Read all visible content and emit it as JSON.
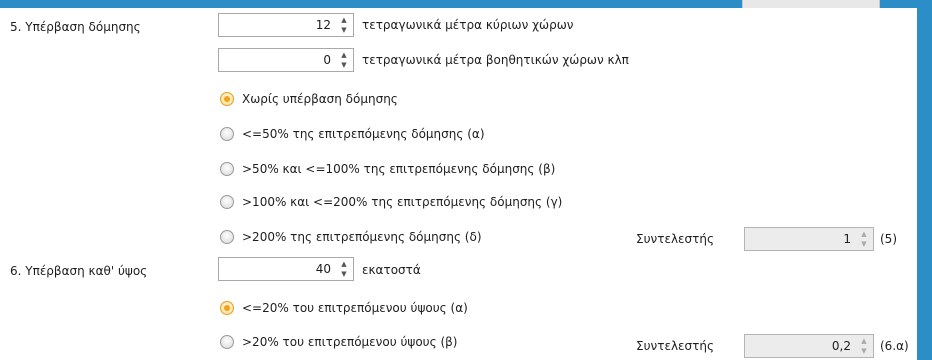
{
  "section5": {
    "label": "5. Υπέρβαση δόμησης",
    "main_area": {
      "value": "12",
      "unit": "τετραγωνικά μέτρα κύριων χώρων"
    },
    "aux_area": {
      "value": "0",
      "unit": "τετραγωνικά μέτρα βοηθητικών χώρων κλπ"
    },
    "options": [
      {
        "label": "Χωρίς υπέρβαση δόμησης",
        "checked": true
      },
      {
        "label": "<=50% της επιτρεπόμενης δόμησης (α)",
        "checked": false
      },
      {
        "label": ">50% και <=100% της επιτρεπόμενης δόμησης (β)",
        "checked": false
      },
      {
        "label": ">100% και <=200% της επιτρεπόμενης δόμησης (γ)",
        "checked": false
      },
      {
        "label": ">200% της επιτρεπόμενης δόμησης (δ)",
        "checked": false
      }
    ],
    "coefficient": {
      "label": "Συντελεστής",
      "value": "1",
      "ref": "(5)"
    }
  },
  "section6": {
    "label": "6. Υπέρβαση καθ' ύψος",
    "height": {
      "value": "40",
      "unit": "εκατοστά"
    },
    "options": [
      {
        "label": "<=20% του επιτρεπόμενου ύψους (α)",
        "checked": true
      },
      {
        "label": ">20% του επιτρεπόμενου ύψους (β)",
        "checked": false
      }
    ],
    "coefficient": {
      "label": "Συντελεστής",
      "value": "0,2",
      "ref": "(6.α)"
    }
  },
  "colors": {
    "frame": "#2c8ec7",
    "radio_selected": "#f0a21c"
  }
}
